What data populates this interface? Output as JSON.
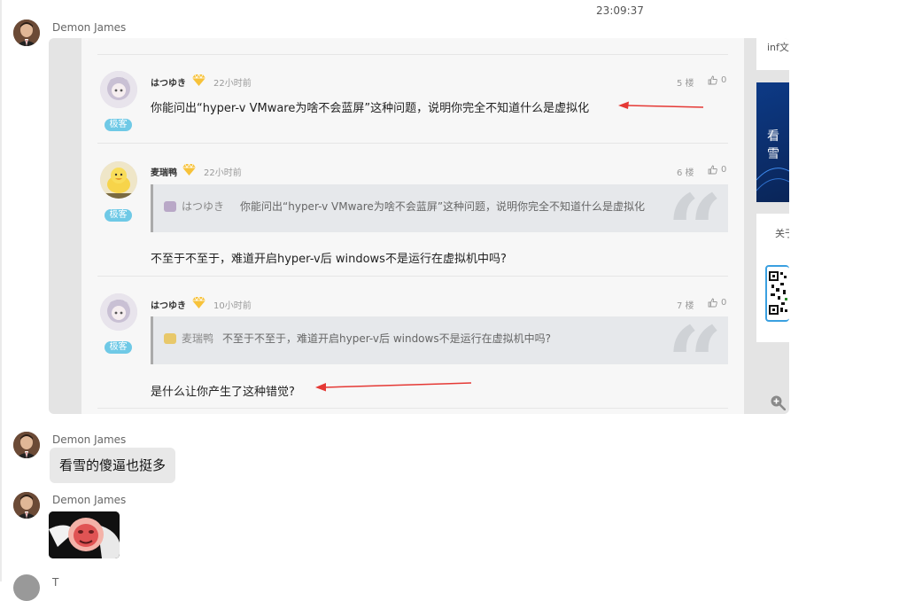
{
  "chat": {
    "timestamp": "23:09:37",
    "messages": [
      {
        "sender": "Demon James",
        "type": "image"
      },
      {
        "sender": "Demon James",
        "type": "text",
        "text": "看雪的傻逼也挺多"
      },
      {
        "sender": "Demon James",
        "type": "sticker"
      },
      {
        "sender": "T"
      }
    ]
  },
  "screenshot": {
    "comments": [
      {
        "username": "はつゆき",
        "time": "22小时前",
        "floor": "5 楼",
        "likes": "0",
        "tag": "极客",
        "body": "你能问出“hyper-v VMware为啥不会蓝屏”这种问题，说明你完全不知道什么是虚拟化"
      },
      {
        "username": "麦瑞鸭",
        "time": "22小时前",
        "floor": "6 楼",
        "likes": "0",
        "tag": "极客",
        "quote_user": "はつゆき",
        "quote_text": "你能问出“hyper-v VMware为啥不会蓝屏”这种问题，说明你完全不知道什么是虚拟化",
        "body": "不至于不至于，难道开启hyper-v后 windows不是运行在虚拟机中吗?"
      },
      {
        "username": "はつゆき",
        "time": "10小时前",
        "floor": "7 楼",
        "likes": "0",
        "tag": "极客",
        "quote_user": "麦瑞鸭",
        "quote_text": "不至于不至于，难道开启hyper-v后 windows不是运行在虚拟机中吗?",
        "body": "是什么让你产生了这种错觉?"
      }
    ],
    "sidebar": {
      "box1_text": "inf文",
      "banner_text": "看雪",
      "box2_title": "关于"
    }
  },
  "colors": {
    "tag": "#6fc9e6",
    "arrow": "#e53935",
    "bubble": "#e8e8e8"
  },
  "icons": [
    "avatar",
    "vip-diamond-icon",
    "thumbs-up-icon",
    "quote-mark-icon",
    "zoom-in-icon",
    "qr-code-icon",
    "red-arrow-icon"
  ]
}
